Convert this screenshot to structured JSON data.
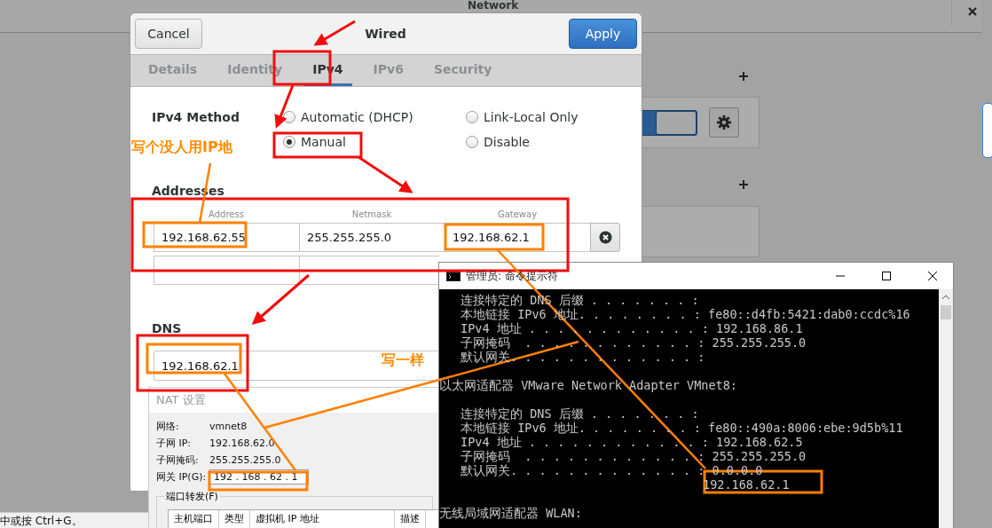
{
  "network_window": {
    "title": "Network",
    "switch": {
      "on": true
    }
  },
  "wired_dialog": {
    "title": "Wired",
    "cancel": "Cancel",
    "apply": "Apply",
    "tabs": [
      {
        "label": "Details",
        "selected": false
      },
      {
        "label": "Identity",
        "selected": false
      },
      {
        "label": "IPv4",
        "selected": true
      },
      {
        "label": "IPv6",
        "selected": false
      },
      {
        "label": "Security",
        "selected": false
      }
    ],
    "method_label": "IPv4 Method",
    "methods": [
      {
        "label": "Automatic (DHCP)",
        "selected": false
      },
      {
        "label": "Link-Local Only",
        "selected": false
      },
      {
        "label": "Manual",
        "selected": true
      },
      {
        "label": "Disable",
        "selected": false
      }
    ],
    "addresses_label": "Addresses",
    "columns": [
      "Address",
      "Netmask",
      "Gateway"
    ],
    "address_rows": [
      {
        "values": [
          "192.168.62.55",
          "255.255.255.0",
          "192.168.62.1"
        ]
      },
      {
        "values": []
      }
    ],
    "dns_label": "DNS",
    "dns_value": "192.168.62.1"
  },
  "nat_dialog": {
    "title": "NAT 设置",
    "fields": [
      {
        "label": "网络:",
        "value": "vmnet8",
        "kind": "text"
      },
      {
        "label": "子网 IP:",
        "value": "192.168.62.0",
        "kind": "text"
      },
      {
        "label": "子网掩码:",
        "value": "255.255.255.0",
        "kind": "text"
      },
      {
        "label": "网关 IP(G):",
        "value": "192 . 168 . 62 . 1",
        "kind": "input"
      }
    ],
    "port_forwarding": "端口转发(F)",
    "columns": [
      "主机端口",
      "类型",
      "虚拟机 IP 地址",
      "描述"
    ]
  },
  "status_bar": "中或按 Ctrl+G。",
  "cmd_window": {
    "title": "管理员: 命令提示符",
    "lines": [
      {
        "kind": "field",
        "text": "连接特定的 DNS 后缀 . . . . . . . :"
      },
      {
        "kind": "field",
        "text": "本地链接 IPv6 地址. . . . . . . . : fe80::d4fb:5421:dab0:ccdc%16"
      },
      {
        "kind": "field",
        "text": "IPv4 地址 . . . . . . . . . . . . : 192.168.86.1"
      },
      {
        "kind": "field",
        "text": "子网掩码  . . . . . . . . . . . . : 255.255.255.0"
      },
      {
        "kind": "field",
        "text": "默认网关. . . . . . . . . . . . . :"
      },
      {
        "kind": "heading",
        "text": "以太网适配器 VMware Network Adapter VMnet8:"
      },
      {
        "kind": "field",
        "text": "连接特定的 DNS 后缀 . . . . . . . :"
      },
      {
        "kind": "field",
        "text": "本地链接 IPv6 地址. . . . . . . . : fe80::490a:8006:ebe:9d5b%11"
      },
      {
        "kind": "field",
        "text": "IPv4 地址 . . . . . . . . . . . . : 192.168.62.5"
      },
      {
        "kind": "field",
        "text": "子网掩码  . . . . . . . . . . . . : 255.255.255.0"
      },
      {
        "kind": "field",
        "text": "默认网关. . . . . . . . . . . . . : 0.0.0.0"
      },
      {
        "kind": "continuation",
        "text": "192.168.62.1"
      },
      {
        "kind": "heading",
        "text": "无线局域网适配器 WLAN:"
      }
    ]
  },
  "annotations": [
    {
      "text": "写个没人用IP地"
    },
    {
      "text": "写一样"
    }
  ]
}
